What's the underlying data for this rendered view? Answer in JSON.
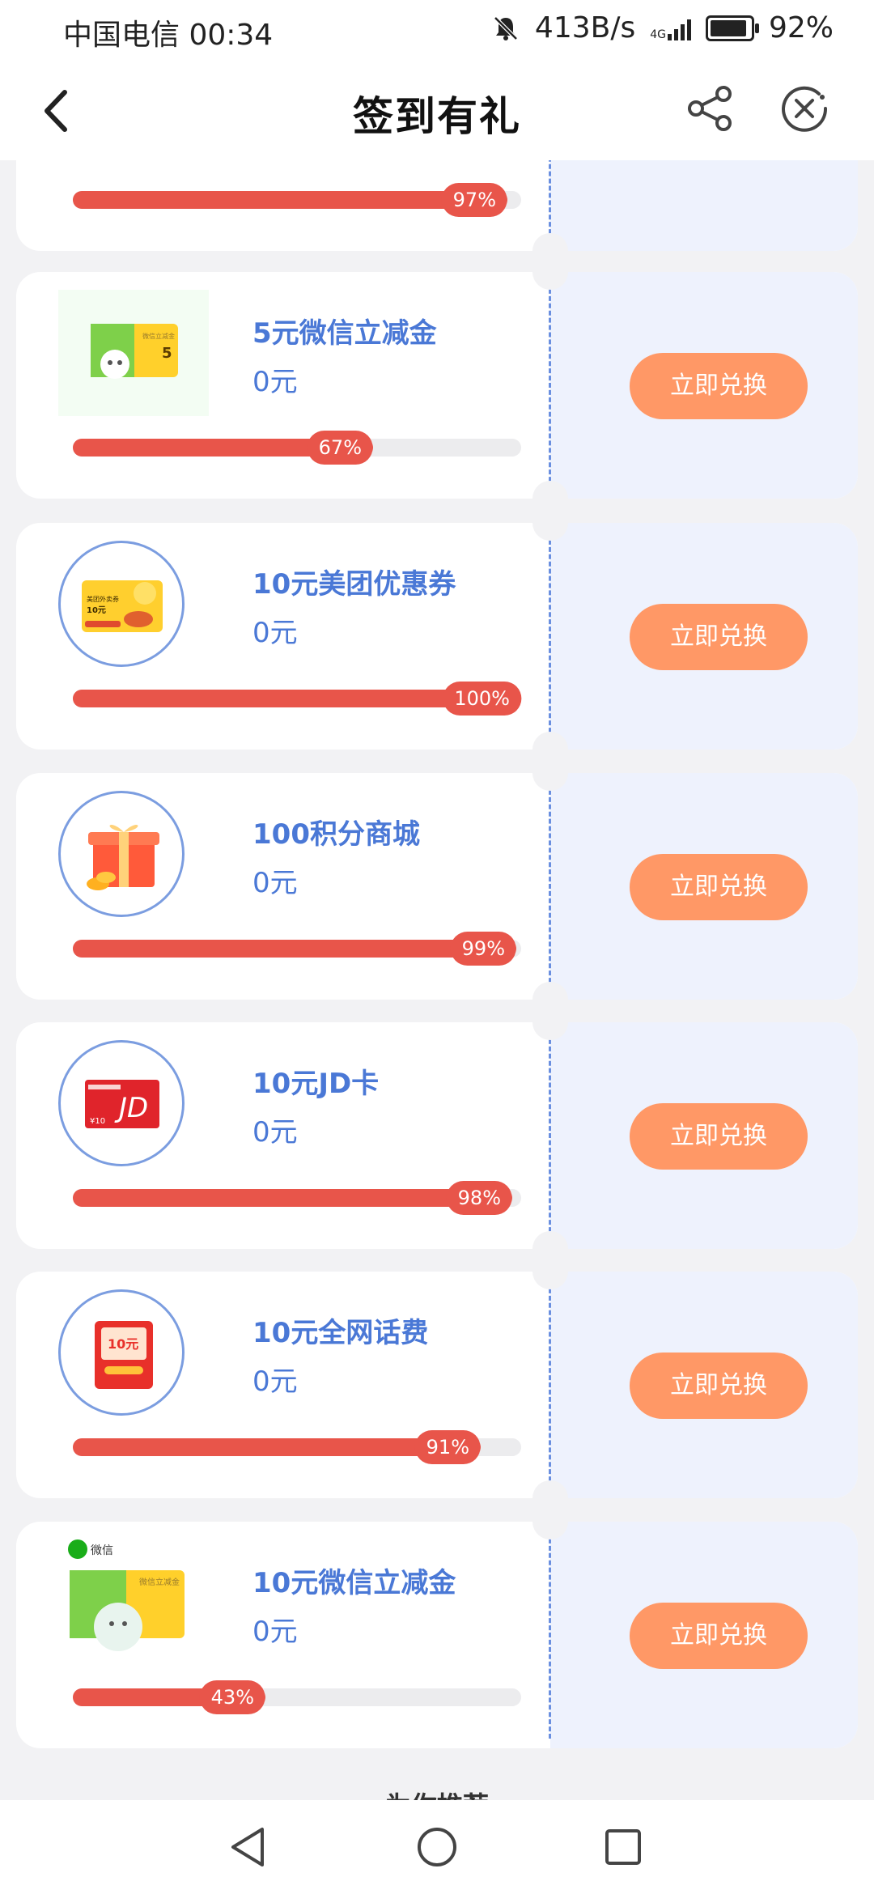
{
  "status_bar": {
    "carrier_time": "中国电信 00:34",
    "speed": "413B/s",
    "network": "4G",
    "battery": "92%"
  },
  "header": {
    "title": "签到有礼"
  },
  "partial_card": {
    "progress": "97%",
    "progress_value": 0.97
  },
  "rewards": [
    {
      "name": "5元微信立减金",
      "price": "0元",
      "progress": "67%",
      "progress_value": 0.67,
      "button": "立即兑换",
      "icon": "wechat-card-5-icon"
    },
    {
      "name": "10元美团优惠券",
      "price": "0元",
      "progress": "100%",
      "progress_value": 1.0,
      "button": "立即兑换",
      "icon": "meituan-coupon-icon"
    },
    {
      "name": "100积分商城",
      "price": "0元",
      "progress": "99%",
      "progress_value": 0.99,
      "button": "立即兑换",
      "icon": "gift-box-icon"
    },
    {
      "name": "10元JD卡",
      "price": "0元",
      "progress": "98%",
      "progress_value": 0.98,
      "button": "立即兑换",
      "icon": "jd-card-icon"
    },
    {
      "name": "10元全网话费",
      "price": "0元",
      "progress": "91%",
      "progress_value": 0.91,
      "button": "立即兑换",
      "icon": "phone-credit-icon"
    },
    {
      "name": "10元微信立减金",
      "price": "0元",
      "progress": "43%",
      "progress_value": 0.43,
      "button": "立即兑换",
      "icon": "wechat-card-10-icon"
    }
  ],
  "thumb_text": {
    "wechat_card": "微信立减金",
    "wechat_value": "5",
    "meituan_line1": "美团外卖券",
    "meituan_line2": "10元",
    "jd_brand": "JD",
    "jd_value": "¥10",
    "phone_value": "10元",
    "wechat_brand": "微信"
  },
  "peek_text": "为你推荐",
  "colors": {
    "accent": "#4a78d6",
    "progress": "#e8554a",
    "button": "#ff9866"
  }
}
